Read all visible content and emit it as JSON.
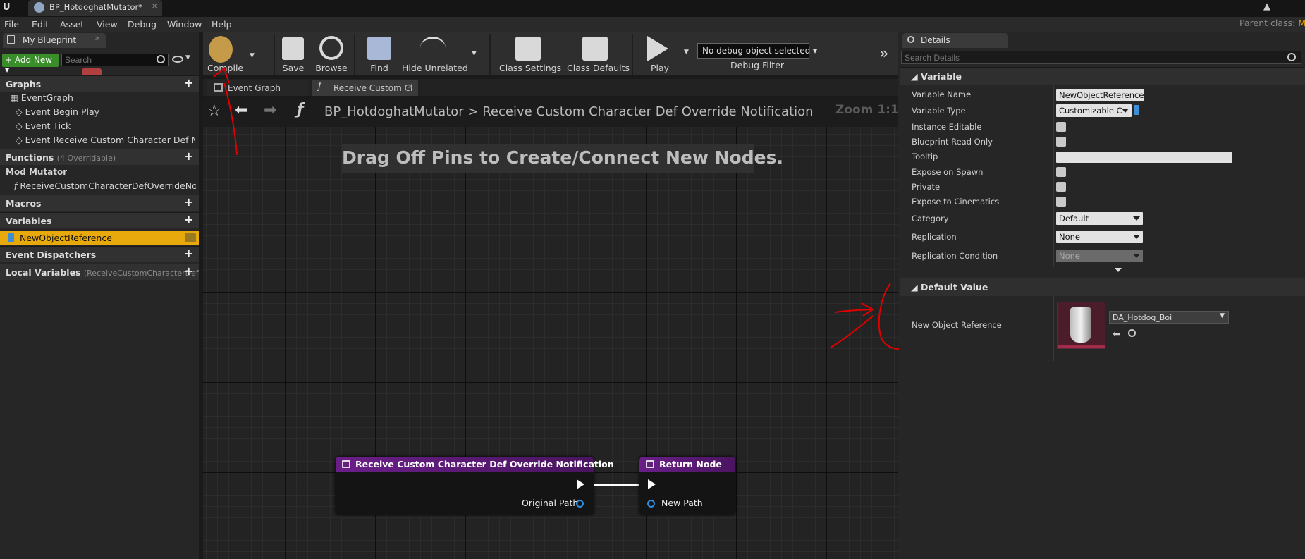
{
  "titlebar": {
    "tab_title": "BP_HotdoghatMutator*",
    "parent_class_label": "Parent class:",
    "parent_class_value": "Mo"
  },
  "menu": [
    "File",
    "Edit",
    "Asset",
    "View",
    "Debug",
    "Window",
    "Help"
  ],
  "my_blueprint": {
    "tab_label": "My Blueprint",
    "add_new_label": "Add New",
    "search_placeholder": "Search",
    "graphs_label": "Graphs",
    "event_graph_label": "EventGraph",
    "events": [
      "Event Begin Play",
      "Event Tick",
      "Event Receive Custom Character Def Mod"
    ],
    "functions_label": "Functions",
    "functions_sub": "(4 Overridable)",
    "mod_mutator_label": "Mod Mutator",
    "function_item": "ReceiveCustomCharacterDefOverrideNo",
    "macros_label": "Macros",
    "variables_label": "Variables",
    "variable_item": "NewObjectReference",
    "event_dispatchers_label": "Event Dispatchers",
    "local_variables_label": "Local Variables",
    "local_variables_sub": "(ReceiveCustomCharacterDefO"
  },
  "toolbar": {
    "compile": "Compile",
    "save": "Save",
    "browse": "Browse",
    "find": "Find",
    "hide_unrelated": "Hide Unrelated",
    "class_settings": "Class Settings",
    "class_defaults": "Class Defaults",
    "play": "Play",
    "debug_object": "No debug object selected",
    "debug_filter": "Debug Filter"
  },
  "graph_tabs": [
    "Event Graph",
    "Receive Custom Cl"
  ],
  "breadcrumb": {
    "root": "BP_HotdoghatMutator",
    "separator": ">",
    "current": "Receive Custom Character Def Override Notification"
  },
  "graph": {
    "hint": "Drag Off Pins to Create/Connect New Nodes.",
    "zoom": "Zoom 1:1",
    "entry_node": {
      "title": "Receive Custom Character Def Override Notification",
      "output_pin": "Original Path"
    },
    "return_node": {
      "title": "Return Node",
      "input_pin": "New Path"
    }
  },
  "details": {
    "tab_label": "Details",
    "search_placeholder": "Search Details",
    "variable_section": "Variable",
    "rows": {
      "variable_name_label": "Variable Name",
      "variable_name_value": "NewObjectReference",
      "variable_type_label": "Variable Type",
      "variable_type_value": "Customizable C",
      "instance_editable_label": "Instance Editable",
      "read_only_label": "Blueprint Read Only",
      "tooltip_label": "Tooltip",
      "expose_spawn_label": "Expose on Spawn",
      "private_label": "Private",
      "expose_cinematics_label": "Expose to Cinematics",
      "category_label": "Category",
      "category_value": "Default",
      "replication_label": "Replication",
      "replication_value": "None",
      "replication_condition_label": "Replication Condition",
      "replication_condition_value": "None"
    },
    "default_value_section": "Default Value",
    "default_value_label": "New Object Reference",
    "default_asset": "DA_Hotdog_Boi"
  },
  "colors": {
    "accent_selection": "#e7a90b",
    "node_header": "#6a1f88",
    "pin_object": "#2d8de0",
    "annotation": "#e00000"
  }
}
